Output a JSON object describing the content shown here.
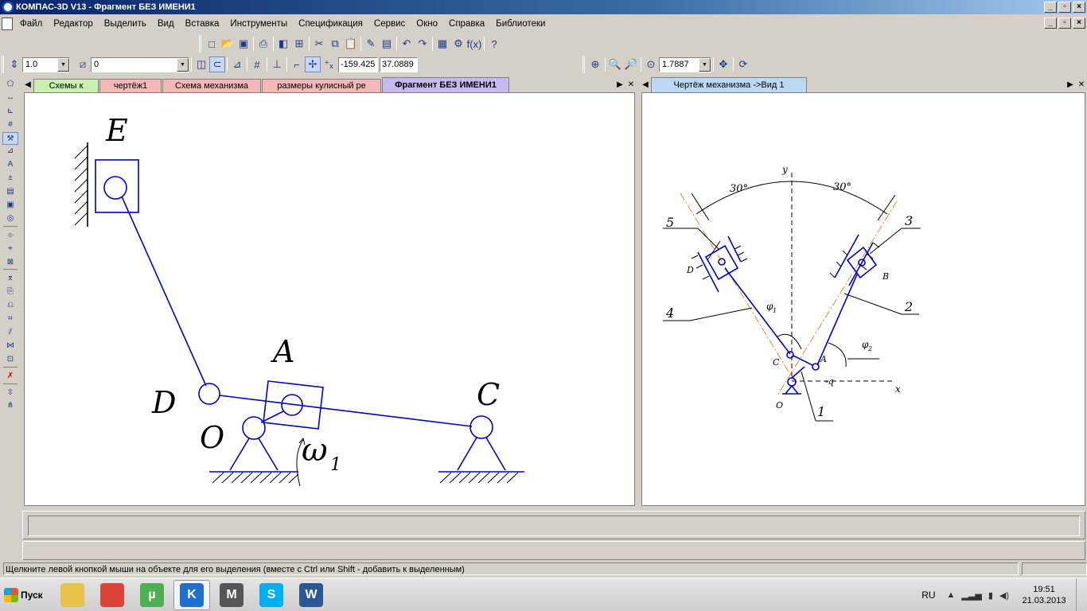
{
  "window": {
    "title": "КОМПАС-3D V13 - Фрагмент БЕЗ ИМЕНИ1"
  },
  "menu": [
    "Файл",
    "Редактор",
    "Выделить",
    "Вид",
    "Вставка",
    "Инструменты",
    "Спецификация",
    "Сервис",
    "Окно",
    "Справка",
    "Библиотеки"
  ],
  "toolbar": {
    "step_value": "1.0",
    "layer_value": "0",
    "coord_x": "-159.425",
    "coord_y": "37.0889",
    "zoom_value": "1.7887"
  },
  "left_pane": {
    "tabs": [
      {
        "label": "Схемы к",
        "color": "#c8f0b0"
      },
      {
        "label": "чертёж1",
        "color": "#f4b8b8"
      },
      {
        "label": "Схема механизма",
        "color": "#f4b8b8"
      },
      {
        "label": "размеры кулисный ре",
        "color": "#f4b8b8"
      },
      {
        "label": "Фрагмент БЕЗ ИМЕНИ1",
        "color": "#c9b8f0"
      }
    ],
    "labels": {
      "E": "E",
      "A": "A",
      "D": "D",
      "C": "C",
      "O": "O",
      "omega": "ω",
      "omega_sub": "1"
    }
  },
  "right_pane": {
    "tab": "Чертёж механизма ->Вид 1",
    "labels": {
      "y": "y",
      "x": "x",
      "angle_left": "30°",
      "angle_right": "30°",
      "n5": "5",
      "n3": "3",
      "n4": "4",
      "n2": "2",
      "n1": "1",
      "D": "D",
      "B": "B",
      "C": "C",
      "A": "A",
      "O": "O",
      "phi1": "φ",
      "phi1_sub": "1",
      "phi2": "φ",
      "phi2_sub": "2",
      "q": "-q"
    }
  },
  "status": {
    "hint": "Щелкните левой кнопкой мыши на объекте для его выделения (вместе с Ctrl или Shift - добавить к выделенным)"
  },
  "taskbar": {
    "start": "Пуск",
    "lang": "RU",
    "time": "19:51",
    "date": "21.03.2013",
    "apps": [
      {
        "icon": "folder-icon",
        "color": "#e8c04a",
        "glyph": ""
      },
      {
        "icon": "chrome-icon",
        "color": "#db4437",
        "glyph": ""
      },
      {
        "icon": "utorrent-icon",
        "color": "#4caf50",
        "glyph": "µ"
      },
      {
        "icon": "kompas-icon",
        "color": "#1e6fd0",
        "glyph": "K"
      },
      {
        "icon": "mathcad-icon",
        "color": "#555555",
        "glyph": "M"
      },
      {
        "icon": "skype-icon",
        "color": "#00aff0",
        "glyph": "S"
      },
      {
        "icon": "word-icon",
        "color": "#2b5797",
        "glyph": "W"
      }
    ]
  }
}
